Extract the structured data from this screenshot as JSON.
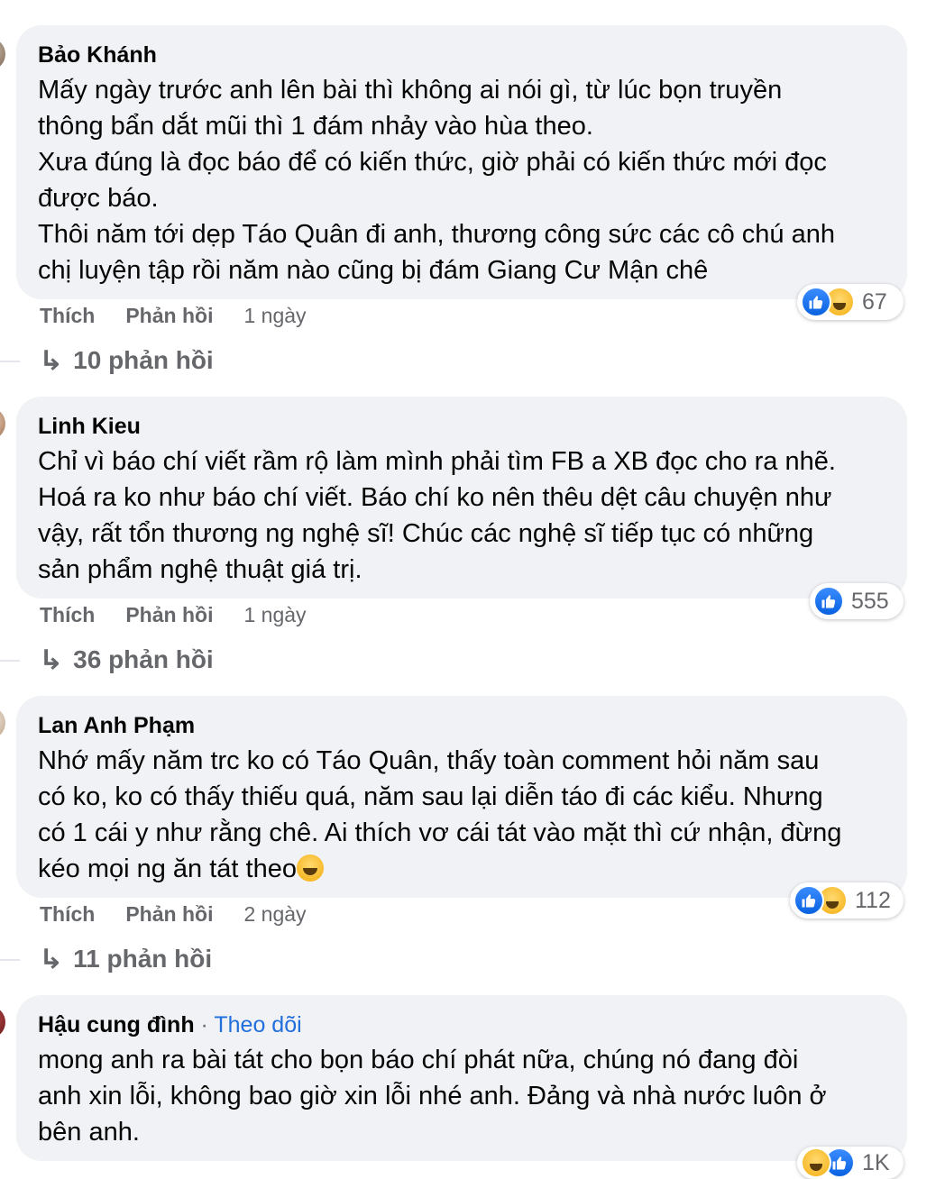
{
  "comments": [
    {
      "author": "Bảo Khánh",
      "follow": "",
      "text": "Mấy ngày trước anh lên bài thì không ai nói gì, từ lúc bọn truyền\nthông bẩn dắt mũi thì 1 đám nhảy vào hùa theo.\nXưa đúng là đọc báo để có kiến thức, giờ phải có kiến thức mới đọc\nđược báo.\nThôi năm tới dẹp Táo Quân đi anh, thương công sức các cô chú anh\nchị luyện tập rồi năm nào cũng bị đám Giang Cư Mận chê",
      "reactions": {
        "types": [
          "like",
          "haha"
        ],
        "count": "67"
      },
      "like_label": "Thích",
      "reply_label": "Phản hồi",
      "time": "1 ngày",
      "replies": "10 phản hồi"
    },
    {
      "author": "Linh Kieu",
      "follow": "",
      "text": "Chỉ vì báo chí viết rầm rộ làm mình phải tìm FB a XB đọc cho ra nhẽ.\nHoá ra ko như báo chí viết. Báo chí ko nên thêu dệt câu chuyện như\nvậy, rất tổn thương ng nghệ sĩ! Chúc các nghệ sĩ tiếp tục có những\nsản phẩm nghệ thuật giá trị.",
      "reactions": {
        "types": [
          "like"
        ],
        "count": "555"
      },
      "like_label": "Thích",
      "reply_label": "Phản hồi",
      "time": "1 ngày",
      "replies": "36 phản hồi"
    },
    {
      "author": "Lan Anh Phạm",
      "follow": "",
      "text": "Nhớ mấy năm trc ko có Táo Quân, thấy toàn comment hỏi năm sau\ncó ko, ko có thấy thiếu quá, năm sau lại diễn táo đi các kiểu. Nhưng\ncó 1 cái y như rằng chê. Ai thích vơ cái tát vào mặt thì cứ nhận, đừng\nkéo mọi ng ăn tát theo",
      "reactions": {
        "types": [
          "like",
          "haha"
        ],
        "count": "112"
      },
      "like_label": "Thích",
      "reply_label": "Phản hồi",
      "time": "2 ngày",
      "replies": "11 phản hồi"
    },
    {
      "author": "Hậu cung đình",
      "follow_sep": " · ",
      "follow": "Theo dõi",
      "text": "mong anh ra bài tát cho bọn báo chí phát nữa, chúng nó đang đòi\nanh xin lỗi, không bao giờ xin lỗi nhé anh. Đảng và nhà nước luôn ở\nbên anh.",
      "reactions": {
        "types": [
          "haha",
          "like"
        ],
        "count": "1K"
      }
    }
  ],
  "colors": {
    "bubble": "#f0f2f5",
    "secondary_text": "#65676b",
    "follow_link": "#216fdb",
    "like_blue": "#0a62e0",
    "haha_yellow": "#f7b928"
  }
}
